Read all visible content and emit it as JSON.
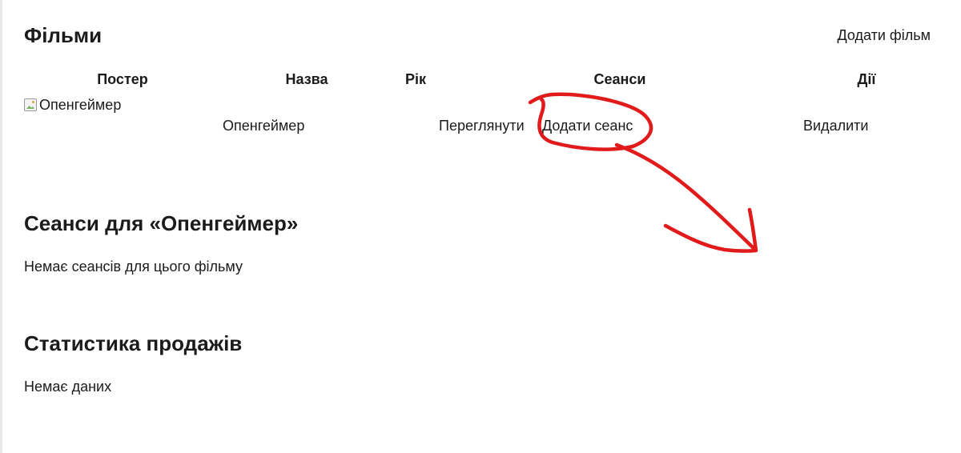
{
  "films": {
    "title": "Фільми",
    "add_film_label": "Додати фільм",
    "columns": [
      "Постер",
      "Назва",
      "Рік",
      "Сеанси",
      "Дії"
    ],
    "rows": [
      {
        "poster_alt": "Опенгеймер",
        "title": "Опенгеймер",
        "year": "",
        "view_label": "Переглянути",
        "add_session_label": "Додати сеанс",
        "delete_label": "Видалити"
      }
    ]
  },
  "sessions": {
    "title": "Сеанси для «Опенгеймер»",
    "empty_text": "Немає сеансів для цього фільму"
  },
  "stats": {
    "title": "Статистика продажів",
    "empty_text": "Немає даних"
  },
  "annotation": {
    "color": "#e11b1b"
  }
}
